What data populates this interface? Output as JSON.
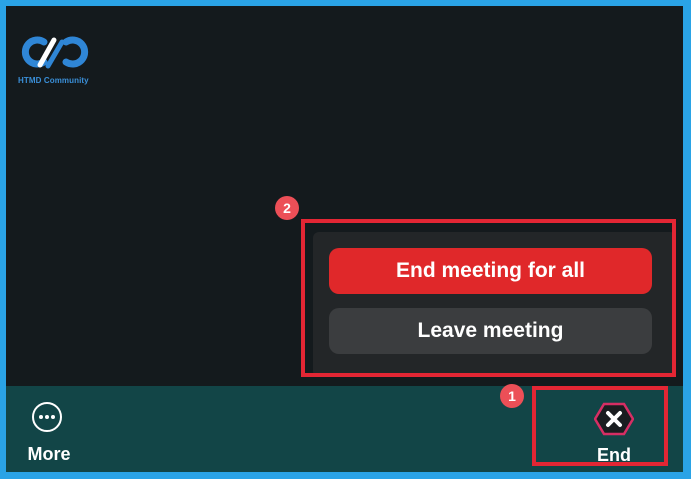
{
  "logo": {
    "text": "HTMD Community",
    "color": "#3a8fd8"
  },
  "end_menu": {
    "end_for_all_label": "End meeting for all",
    "leave_label": "Leave meeting",
    "end_for_all_color": "#e0282a",
    "leave_color": "#3b3d3f"
  },
  "toolbar": {
    "more_label": "More",
    "more_icon": "ellipsis-circle-icon",
    "end_label": "End",
    "end_icon": "close-hexagon-icon",
    "background_color": "#124547"
  },
  "annotations": {
    "step_1": "1",
    "step_2": "2",
    "highlight_color": "#e32634",
    "badge_color": "#ec4f57"
  }
}
